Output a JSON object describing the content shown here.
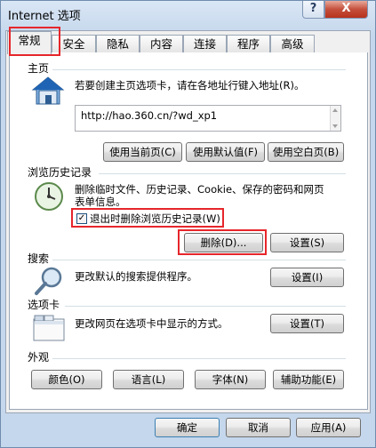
{
  "window": {
    "title": "Internet 选项",
    "help_label": "?",
    "close_label": "X"
  },
  "tabs": [
    "常规",
    "安全",
    "隐私",
    "内容",
    "连接",
    "程序",
    "高级"
  ],
  "homepage": {
    "heading": "主页",
    "description": "若要创建主页选项卡，请在各地址行键入地址(R)。",
    "url": "http://hao.360.cn/?wd_xp1",
    "buttons": [
      "使用当前页(C)",
      "使用默认值(F)",
      "使用空白页(B)"
    ]
  },
  "history": {
    "heading": "浏览历史记录",
    "description_line1": "删除临时文件、历史记录、Cookie、保存的密码和网页",
    "description_line2": "表单信息。",
    "checkbox_label": "退出时删除浏览历史记录(W)",
    "checkbox_mark": "✓",
    "checkbox_checked": true,
    "delete_button": "删除(D)...",
    "settings_button": "设置(S)"
  },
  "search": {
    "heading": "搜索",
    "description": "更改默认的搜索提供程序。",
    "settings_button": "设置(I)"
  },
  "tabs_section": {
    "heading": "选项卡",
    "description": "更改网页在选项卡中显示的方式。",
    "settings_button": "设置(T)"
  },
  "appearance": {
    "heading": "外观",
    "buttons": [
      "颜色(O)",
      "语言(L)",
      "字体(N)",
      "辅助功能(E)"
    ]
  },
  "footer": {
    "ok": "确定",
    "cancel": "取消",
    "apply": "应用(A)"
  },
  "colors": {
    "highlight": "#e6262b",
    "close_button": "#c4503c"
  }
}
